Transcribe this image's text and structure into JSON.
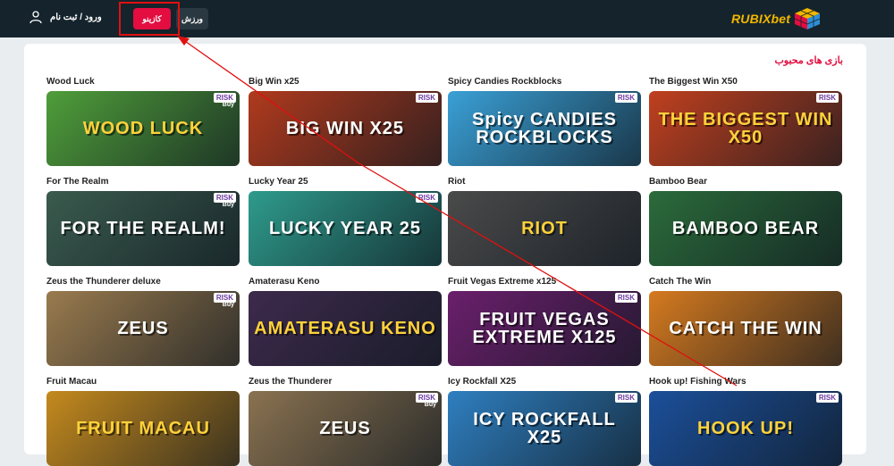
{
  "header": {
    "logo_text": "RUBIXbet",
    "login_label": "ورود / ثبت نام",
    "nav_casino": "کازینو",
    "nav_sport": "ورزش"
  },
  "section": {
    "title": "بازی های محبوب"
  },
  "games": [
    {
      "title": "Wood Luck",
      "thumb_text": "WOOD LUCK",
      "color": "#4f9e3a",
      "risk": "RISK",
      "buy": "Buy"
    },
    {
      "title": "Big Win x25",
      "thumb_text": "BIG WIN X25",
      "color": "#b03a1d",
      "risk": "RISK",
      "buy": ""
    },
    {
      "title": "Spicy Candies Rockblocks",
      "thumb_text": "Spicy CANDIES ROCKBLOCKS",
      "color": "#3aa0d6",
      "risk": "RISK",
      "buy": ""
    },
    {
      "title": "The Biggest Win X50",
      "thumb_text": "THE BIGGEST WIN X50",
      "color": "#c0401f",
      "risk": "RISK",
      "buy": ""
    },
    {
      "title": "For The Realm",
      "thumb_text": "FOR THE REALM!",
      "color": "#3a5b4e",
      "risk": "RISK",
      "buy": "Buy"
    },
    {
      "title": "Lucky Year 25",
      "thumb_text": "LUCKY YEAR 25",
      "color": "#2e9b8c",
      "risk": "RISK",
      "buy": ""
    },
    {
      "title": "Riot",
      "thumb_text": "RIOT",
      "color": "#4a4a4a",
      "risk": "",
      "buy": ""
    },
    {
      "title": "Bamboo Bear",
      "thumb_text": "BAMBOO BEAR",
      "color": "#2b6b3a",
      "risk": "",
      "buy": ""
    },
    {
      "title": "Zeus the Thunderer deluxe",
      "thumb_text": "ZEUS",
      "color": "#9a7b4e",
      "risk": "RISK",
      "buy": "Buy"
    },
    {
      "title": "Amaterasu Keno",
      "thumb_text": "AMATERASU KENO",
      "color": "#3d2a4c",
      "risk": "",
      "buy": ""
    },
    {
      "title": "Fruit Vegas Extreme x125",
      "thumb_text": "FRUIT VEGAS EXTREME X125",
      "color": "#6a1f6b",
      "risk": "RISK",
      "buy": ""
    },
    {
      "title": "Catch The Win",
      "thumb_text": "CATCH THE WIN",
      "color": "#d57a1f",
      "risk": "",
      "buy": ""
    },
    {
      "title": "Fruit Macau",
      "thumb_text": "FRUIT MACAU",
      "color": "#c58a1e",
      "risk": "",
      "buy": ""
    },
    {
      "title": "Zeus the Thunderer",
      "thumb_text": "ZEUS",
      "color": "#8a7250",
      "risk": "RISK",
      "buy": "Buy"
    },
    {
      "title": "Icy Rockfall X25",
      "thumb_text": "ICY ROCKFALL X25",
      "color": "#2f7fc0",
      "risk": "RISK",
      "buy": ""
    },
    {
      "title": "Hook up! Fishing Wars",
      "thumb_text": "HOOK UP!",
      "color": "#1b4f9a",
      "risk": "RISK",
      "buy": ""
    }
  ],
  "colors": {
    "accent": "#e30d3f",
    "topbar": "#15242c",
    "logo": "#f2b600"
  }
}
